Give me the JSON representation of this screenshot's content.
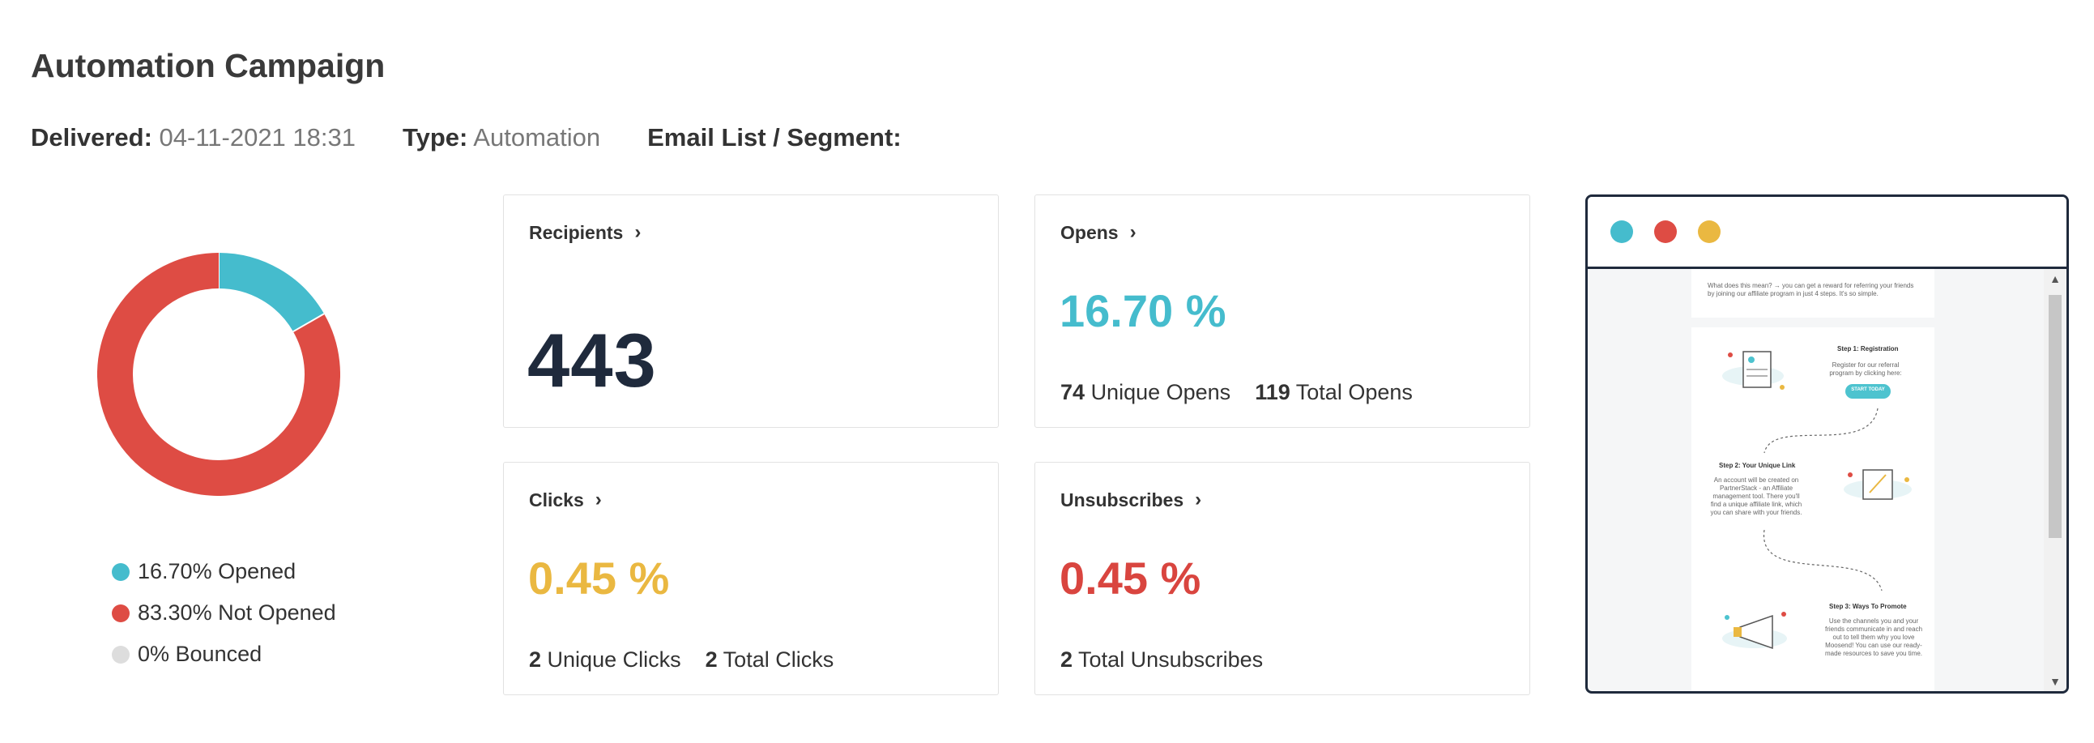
{
  "title": "Automation Campaign",
  "meta": {
    "delivered_label": "Delivered:",
    "delivered_value": "04-11-2021 18:31",
    "type_label": "Type:",
    "type_value": "Automation",
    "list_label": "Email List / Segment:"
  },
  "chart_data": {
    "type": "pie",
    "categories": [
      "Opened",
      "Not Opened",
      "Bounced"
    ],
    "values": [
      16.7,
      83.3,
      0
    ],
    "colors": [
      "#45bccd",
      "#de4c44",
      "#dddddd"
    ],
    "legend": [
      "16.70% Opened",
      "83.30% Not Opened",
      "0% Bounced"
    ]
  },
  "cards": {
    "recipients": {
      "label": "Recipients",
      "value": "443"
    },
    "opens": {
      "label": "Opens",
      "value": "16.70 %",
      "unique_num": "74",
      "unique_label": "Unique Opens",
      "total_num": "119",
      "total_label": "Total Opens",
      "color": "#45bccd"
    },
    "clicks": {
      "label": "Clicks",
      "value": "0.45 %",
      "unique_num": "2",
      "unique_label": "Unique Clicks",
      "total_num": "2",
      "total_label": "Total Clicks",
      "color": "#eab841"
    },
    "unsubscribes": {
      "label": "Unsubscribes",
      "value": "0.45 %",
      "total_num": "2",
      "total_label": "Total Unsubscribes",
      "color": "#d9453f"
    }
  },
  "preview": {
    "dots": [
      "#45bccd",
      "#de4c44",
      "#eab841"
    ],
    "text_intro": "What does this mean? → you can get a reward for referring your friends by joining our affiliate program in just 4 steps. It's so simple.",
    "step1_title": "Step 1: Registration",
    "step1_text": "Register for our referral program by clicking here:",
    "step1_button": "START TODAY",
    "step2_title": "Step 2: Your Unique Link",
    "step2_text": "An account will be created on PartnerStack - an Affiliate management tool. There you'll find a unique affiliate link, which you can share with your friends.",
    "step3_title": "Step 3: Ways To Promote",
    "step3_text": "Use the channels you and your friends communicate in and reach out to tell them why you love Moosend! You can use our ready-made resources to save you time."
  }
}
